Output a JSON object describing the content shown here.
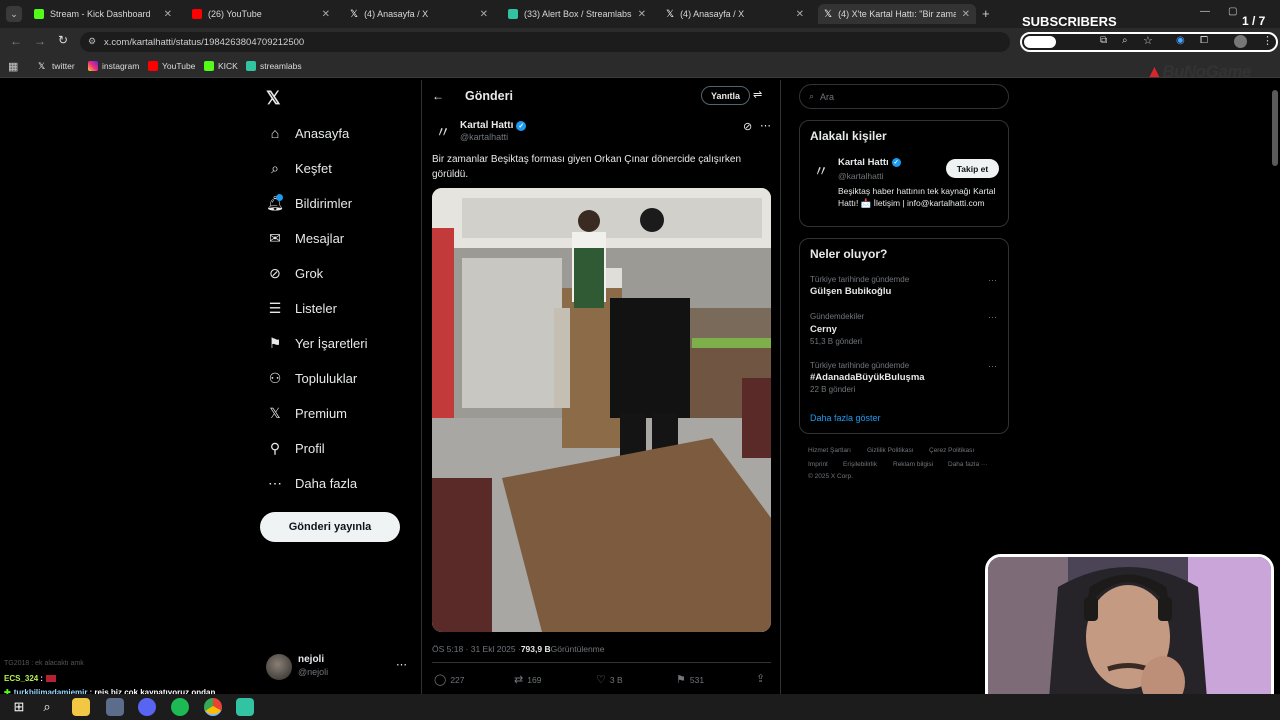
{
  "tabs": [
    {
      "title": "Stream - Kick Dashboard"
    },
    {
      "title": "(26) YouTube"
    },
    {
      "title": "(4) Anasayfa / X"
    },
    {
      "title": "(33) Alert Box / Streamlabs"
    },
    {
      "title": "(4) Anasayfa / X"
    },
    {
      "title": "(4) X'te Kartal Hattı: \"Bir zaman"
    }
  ],
  "url": "x.com/kartalhatti/status/1984263804709212500",
  "bookmarks": [
    "twitter",
    "instagram",
    "YouTube",
    "KICK",
    "streamlabs"
  ],
  "overlay": {
    "subscribers_label": "SUBSCRIBERS",
    "counter": "1 / 7",
    "brand": "BuNoGame"
  },
  "nav": [
    {
      "label": "Anasayfa",
      "icon": "home-icon"
    },
    {
      "label": "Keşfet",
      "icon": "search-icon"
    },
    {
      "label": "Bildirimler",
      "icon": "bell-icon"
    },
    {
      "label": "Mesajlar",
      "icon": "mail-icon"
    },
    {
      "label": "Grok",
      "icon": "grok-icon"
    },
    {
      "label": "Listeler",
      "icon": "list-icon"
    },
    {
      "label": "Yer İşaretleri",
      "icon": "bookmark-icon"
    },
    {
      "label": "Topluluklar",
      "icon": "communities-icon"
    },
    {
      "label": "Premium",
      "icon": "x-logo-icon"
    },
    {
      "label": "Profil",
      "icon": "profile-icon"
    },
    {
      "label": "Daha fazla",
      "icon": "more-circle-icon"
    }
  ],
  "post_button": "Gönderi yayınla",
  "account": {
    "name": "nejoli",
    "handle": "@nejoli"
  },
  "header": {
    "title": "Gönderi",
    "reply_button": "Yanıtla"
  },
  "tweet": {
    "author": "Kartal Hattı",
    "handle": "@kartalhatti",
    "text": "Bir zamanlar Beşiktaş forması giyen Orkan Çınar dönercide çalışırken görüldü.",
    "timestamp": "ÖS 5:18 · 31 Ekl 2025 · ",
    "views": "793,9 B",
    "views_label": " Görüntülenme",
    "replies": "227",
    "reposts": "169",
    "likes": "3 B",
    "bookmarks": "531"
  },
  "search": {
    "placeholder": "Ara"
  },
  "related": {
    "title": "Alakalı kişiler",
    "name": "Kartal Hattı",
    "handle": "@kartalhatti",
    "follow": "Takip et",
    "bio": "Beşiktaş haber hattının tek kaynağı Kartal Hattı! 📩 İletişim | info@kartalhatti.com"
  },
  "trends": {
    "title": "Neler oluyor?",
    "items": [
      {
        "category": "Türkiye tarihinde gündemde",
        "name": "Gülşen Bubikoğlu",
        "count": ""
      },
      {
        "category": "Gündemdekiler",
        "name": "Cerny",
        "count": "51,3 B gönderi"
      },
      {
        "category": "Türkiye tarihinde gündemde",
        "name": "#AdanadaBüyükBuluşma",
        "count": "22 B gönderi"
      }
    ],
    "show_more": "Daha fazla göster"
  },
  "footer": [
    "Hizmet Şartları",
    "Gizlilik Politikası",
    "Çerez Politikası",
    "Imprint",
    "Erişilebilirlik",
    "Reklam bilgisi",
    "Daha fazla ···",
    "© 2025 X Corp."
  ],
  "chat": [
    {
      "user": "",
      "text": "TG2018 : ek alacaktı amk"
    },
    {
      "user": "ECS_324",
      "text": ":"
    },
    {
      "user": "turkbilimadamiemir",
      "text": ": reis biz çok kaynatıyoruz ondan"
    }
  ],
  "colors": {
    "bg": "#000000",
    "border": "#2f3336",
    "verified": "#1d9bf0",
    "muted": "#71767b",
    "link": "#1d9bf0"
  }
}
